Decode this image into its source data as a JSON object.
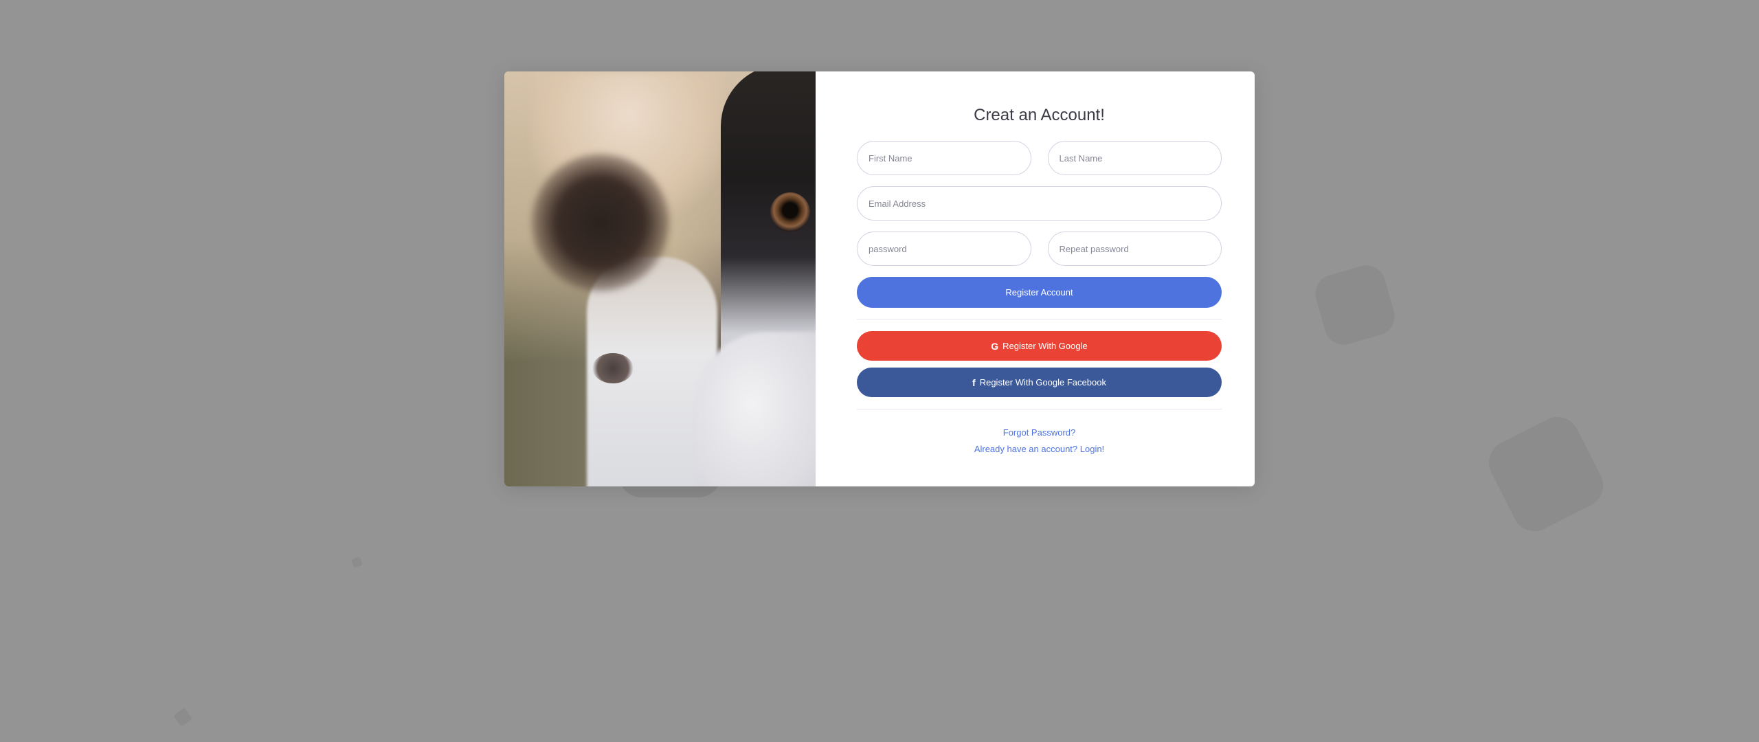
{
  "form": {
    "title": "Creat an Account!",
    "first_name_placeholder": "First Name",
    "last_name_placeholder": "Last Name",
    "email_placeholder": "Email Address",
    "password_placeholder": "password",
    "repeat_password_placeholder": "Repeat password",
    "register_button": "Register Account",
    "google_button": "Register With Google",
    "google_icon": "google-icon",
    "google_icon_glyph": "G",
    "facebook_button": "Register With Google Facebook",
    "facebook_icon": "facebook-icon",
    "facebook_icon_glyph": "f",
    "forgot_password_link": "Forgot Password?",
    "login_link": "Already have an account? Login!"
  },
  "colors": {
    "primary": "#4e73df",
    "google": "#ea4335",
    "facebook": "#3b5998",
    "background": "#949494"
  }
}
